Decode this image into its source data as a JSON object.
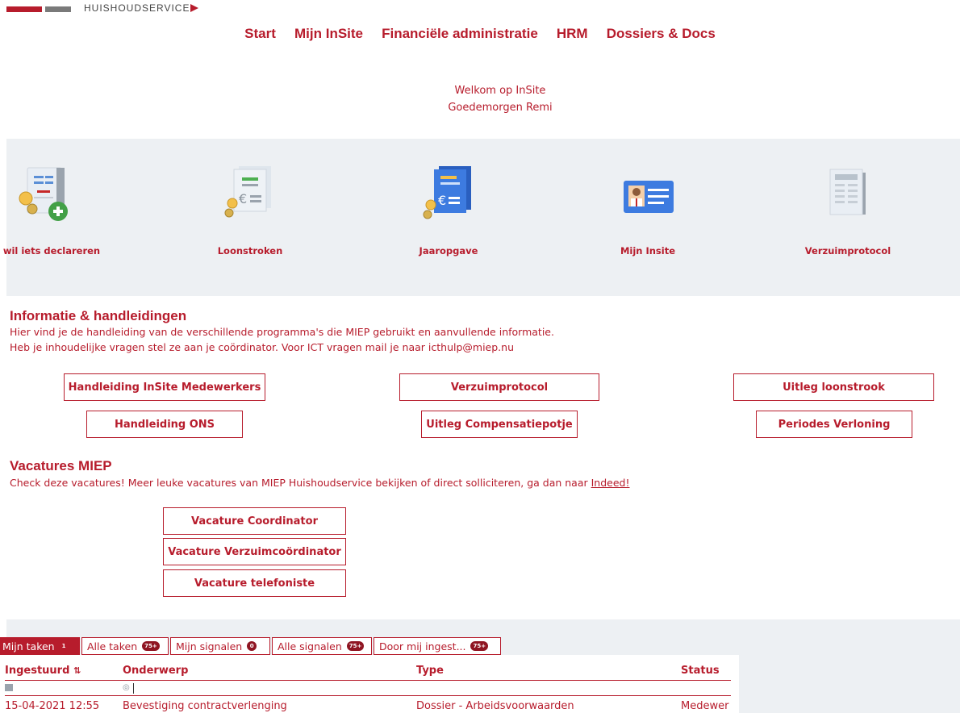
{
  "logo": {
    "text": "HUISHOUDSERVICE"
  },
  "nav": [
    "Start",
    "Mijn InSite",
    "Financiële administratie",
    "HRM",
    "Dossiers & Docs"
  ],
  "welcome": {
    "line1": "Welkom op InSite",
    "line2": "Goedemorgen Remi"
  },
  "tiles": [
    {
      "label": "Ik wil iets declareren",
      "icon": "receipt-add-icon"
    },
    {
      "label": "Loonstroken",
      "icon": "payslip-euro-icon"
    },
    {
      "label": "Jaaropgave",
      "icon": "annual-statement-icon"
    },
    {
      "label": "Mijn Insite",
      "icon": "id-card-icon"
    },
    {
      "label": "Verzuimprotocol",
      "icon": "newspaper-icon"
    }
  ],
  "info": {
    "title": "Informatie & handleidingen",
    "line1": "Hier vind je de handleiding van de verschillende programma's die MIEP gebruikt en aanvullende informatie.",
    "line2": "Heb je inhoudelijke vragen stel ze aan je coördinator. Voor ICT vragen mail je naar icthulp@miep.nu",
    "buttons": [
      "Handleiding InSite Medewerkers",
      "Verzuimprotocol",
      "Uitleg loonstrook",
      "Handleiding ONS",
      "Uitleg Compensatiepotje",
      "Periodes Verloning"
    ]
  },
  "vacatures": {
    "title": "Vacatures MIEP",
    "text": "Check deze vacatures! Meer leuke vacatures van MIEP Huishoudservice bekijken of direct solliciteren, ga dan naar",
    "link": "Indeed!",
    "buttons": [
      "Vacature Coordinator",
      "Vacature Verzuimcoördinator",
      "Vacature telefoniste"
    ]
  },
  "tasks": {
    "tabs": [
      {
        "label": "Mijn taken",
        "badge": "1"
      },
      {
        "label": "Alle taken",
        "badge": "75+"
      },
      {
        "label": "Mijn signalen",
        "badge": "0"
      },
      {
        "label": "Alle signalen",
        "badge": "75+"
      },
      {
        "label": "Door mij ingest...",
        "badge": "75+"
      }
    ],
    "columns": [
      "Ingestuurd",
      "Onderwerp",
      "Type",
      "Status"
    ],
    "rows": [
      {
        "date": "15-04-2021 12:55",
        "subject": "Bevestiging contractverlenging",
        "type": "Dossier - Arbeidsvoorwaarden",
        "status": "Medewer"
      }
    ]
  },
  "colors": {
    "accent": "#b71c2c",
    "panel": "#edf0f3"
  }
}
